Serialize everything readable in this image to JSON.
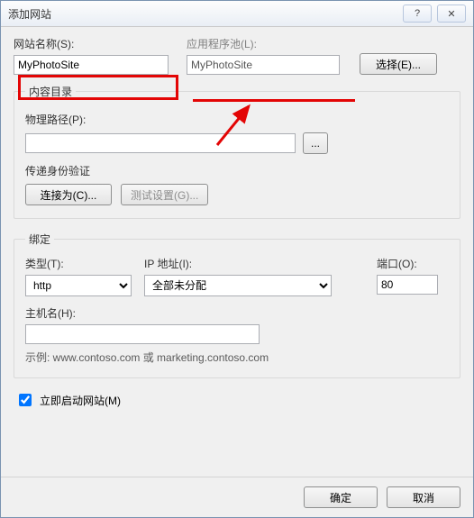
{
  "window": {
    "title": "添加网站"
  },
  "winctrl": {
    "help_glyph": "?",
    "close_glyph": "✕"
  },
  "sitename": {
    "label": "网站名称(S):",
    "value": "MyPhotoSite"
  },
  "apppool": {
    "label": "应用程序池(L):",
    "value": "MyPhotoSite",
    "select_btn": "选择(E)..."
  },
  "content": {
    "legend": "内容目录",
    "phys_label": "物理路径(P):",
    "phys_value": "",
    "browse_glyph": "...",
    "passthru_label": "传递身份验证",
    "connect_as_btn": "连接为(C)...",
    "test_btn": "测试设置(G)..."
  },
  "binding": {
    "legend": "绑定",
    "type_label": "类型(T):",
    "type_value": "http",
    "ip_label": "IP 地址(I):",
    "ip_value": "全部未分配",
    "port_label": "端口(O):",
    "port_value": "80",
    "host_label": "主机名(H):",
    "host_value": "",
    "example": "示例: www.contoso.com 或 marketing.contoso.com"
  },
  "autostart": {
    "label": "立即启动网站(M)"
  },
  "footer": {
    "ok": "确定",
    "cancel": "取消"
  }
}
